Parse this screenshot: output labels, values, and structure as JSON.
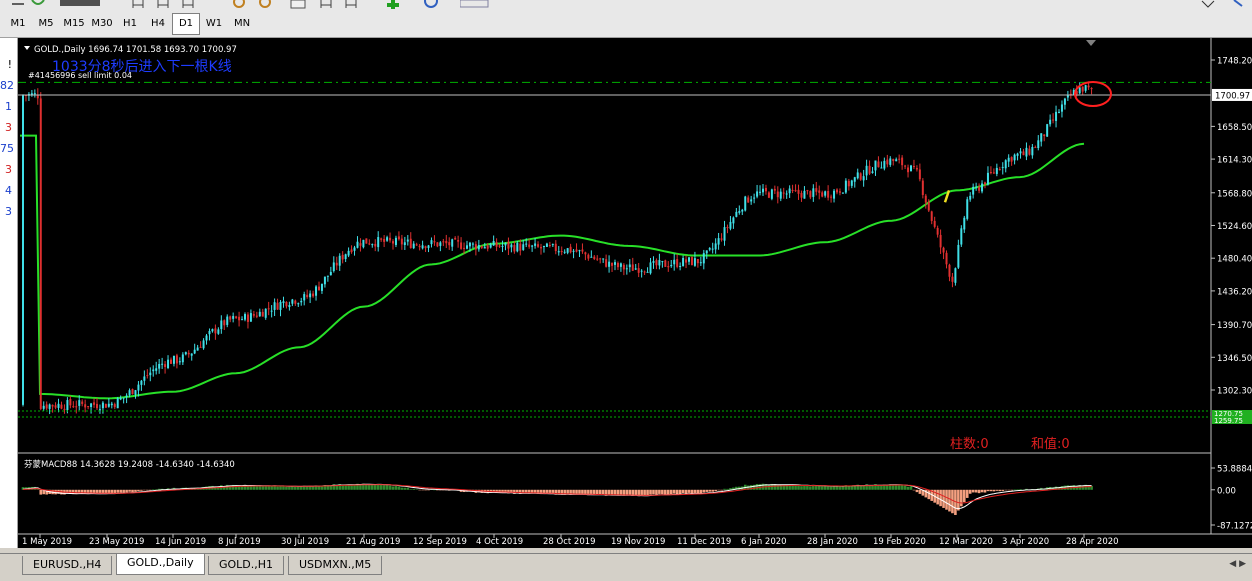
{
  "toolbar": {
    "timeframes": [
      "M1",
      "M5",
      "M15",
      "M30",
      "H1",
      "H4",
      "D1",
      "W1",
      "MN"
    ],
    "active_timeframe": "D1"
  },
  "left_strip": [
    "!",
    "82",
    "1",
    "3",
    "75",
    "3",
    "4",
    "3"
  ],
  "chart": {
    "symbol_line": "GOLD.,Daily  1696.74 1701.58 1693.70 1700.97",
    "annotation": "1033分8秒后进入下一根K线",
    "order_label": "#41456996 sell limit 0.04",
    "price_marker": "1700.97",
    "green_markers": [
      "1270.75",
      "1259.75"
    ],
    "macd_label": "芬蒙MACD88 14.3628 19.2408 -14.6340 -14.6340",
    "macd_text_1": "柱数:0",
    "macd_text_2": "和值:0",
    "colors": {
      "background": "#000000",
      "bull_candle": "#40e0e8",
      "bear_candle": "#e03030",
      "ma_line": "#28e028",
      "macd_pos": "#2e8b2e",
      "macd_neg": "#f4a080",
      "price_line": "#c0c0c0",
      "order_line": "#00b000",
      "highlight_circle": "#ff2020",
      "annotation_text": "#1e3cff",
      "macd_text": "#e02020"
    }
  },
  "chart_data": {
    "type": "candlestick",
    "price_axis_ticks": [
      "1748.20",
      "1700.97",
      "1658.50",
      "1614.30",
      "1568.80",
      "1524.60",
      "1480.40",
      "1436.20",
      "1390.70",
      "1346.50",
      "1302.30"
    ],
    "price_range": [
      1255,
      1765
    ],
    "macd_axis_ticks": [
      "53.8884",
      "0.00",
      "-87.1272"
    ],
    "date_labels": [
      "1 May 2019",
      "23 May 2019",
      "14 Jun 2019",
      "8 Jul 2019",
      "30 Jul 2019",
      "21 Aug 2019",
      "12 Sep 2019",
      "4 Oct 2019",
      "28 Oct 2019",
      "19 Nov 2019",
      "11 Dec 2019",
      "6 Jan 2020",
      "28 Jan 2020",
      "19 Feb 2020",
      "12 Mar 2020",
      "3 Apr 2020",
      "28 Apr 2020"
    ],
    "close_anchors": [
      {
        "date": "1 May 2019",
        "close": 1282
      },
      {
        "date": "23 May 2019",
        "close": 1283
      },
      {
        "date": "14 Jun 2019",
        "close": 1342
      },
      {
        "date": "8 Jul 2019",
        "close": 1398
      },
      {
        "date": "30 Jul 2019",
        "close": 1425
      },
      {
        "date": "21 Aug 2019",
        "close": 1503
      },
      {
        "date": "12 Sep 2019",
        "close": 1500
      },
      {
        "date": "4 Oct 2019",
        "close": 1497
      },
      {
        "date": "28 Oct 2019",
        "close": 1493
      },
      {
        "date": "19 Nov 2019",
        "close": 1467
      },
      {
        "date": "11 Dec 2019",
        "close": 1476
      },
      {
        "date": "6 Jan 2020",
        "close": 1568
      },
      {
        "date": "28 Jan 2020",
        "close": 1568
      },
      {
        "date": "19 Feb 2020",
        "close": 1612
      },
      {
        "date": "12 Mar 2020",
        "close": 1560
      },
      {
        "date": "3 Apr 2020",
        "close": 1620
      },
      {
        "date": "28 Apr 2020",
        "close": 1710
      },
      {
        "date": "end",
        "close": 1701
      }
    ],
    "ma_anchors": [
      {
        "date": "1 May 2019",
        "value": 1297
      },
      {
        "date": "23 May 2019",
        "value": 1291
      },
      {
        "date": "14 Jun 2019",
        "value": 1300
      },
      {
        "date": "8 Jul 2019",
        "value": 1325
      },
      {
        "date": "30 Jul 2019",
        "value": 1360
      },
      {
        "date": "21 Aug 2019",
        "value": 1415
      },
      {
        "date": "12 Sep 2019",
        "value": 1472
      },
      {
        "date": "4 Oct 2019",
        "value": 1500
      },
      {
        "date": "28 Oct 2019",
        "value": 1511
      },
      {
        "date": "19 Nov 2019",
        "value": 1497
      },
      {
        "date": "11 Dec 2019",
        "value": 1484
      },
      {
        "date": "6 Jan 2020",
        "value": 1484
      },
      {
        "date": "28 Jan 2020",
        "value": 1502
      },
      {
        "date": "19 Feb 2020",
        "value": 1531
      },
      {
        "date": "12 Mar 2020",
        "value": 1572
      },
      {
        "date": "3 Apr 2020",
        "value": 1590
      },
      {
        "date": "28 Apr 2020",
        "value": 1635
      },
      {
        "date": "end",
        "value": 1646
      }
    ],
    "current_price": 1700.97,
    "sell_limit_price": 1718,
    "macd_range": [
      -95,
      60
    ]
  }
}
